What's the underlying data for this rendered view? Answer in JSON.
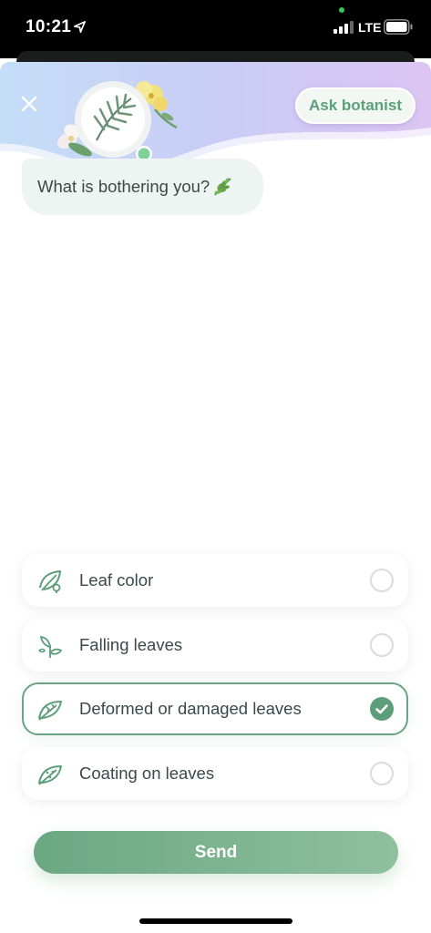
{
  "status_bar": {
    "time": "10:21",
    "network": "LTE"
  },
  "header": {
    "ask_botanist_label": "Ask botanist"
  },
  "chat": {
    "question": "What is bothering you?"
  },
  "options": [
    {
      "label": "Leaf color",
      "icon": "leaf-color-icon",
      "selected": false
    },
    {
      "label": "Falling leaves",
      "icon": "falling-leaves-icon",
      "selected": false
    },
    {
      "label": "Deformed or damaged leaves",
      "icon": "damaged-leaf-icon",
      "selected": true
    },
    {
      "label": "Coating on leaves",
      "icon": "coated-leaf-icon",
      "selected": false
    }
  ],
  "send_label": "Send",
  "colors": {
    "accent": "#5c9e79",
    "bubble": "#eef4f1",
    "header_gradient_start": "#c6def6",
    "header_gradient_end": "#d9c6f3"
  }
}
